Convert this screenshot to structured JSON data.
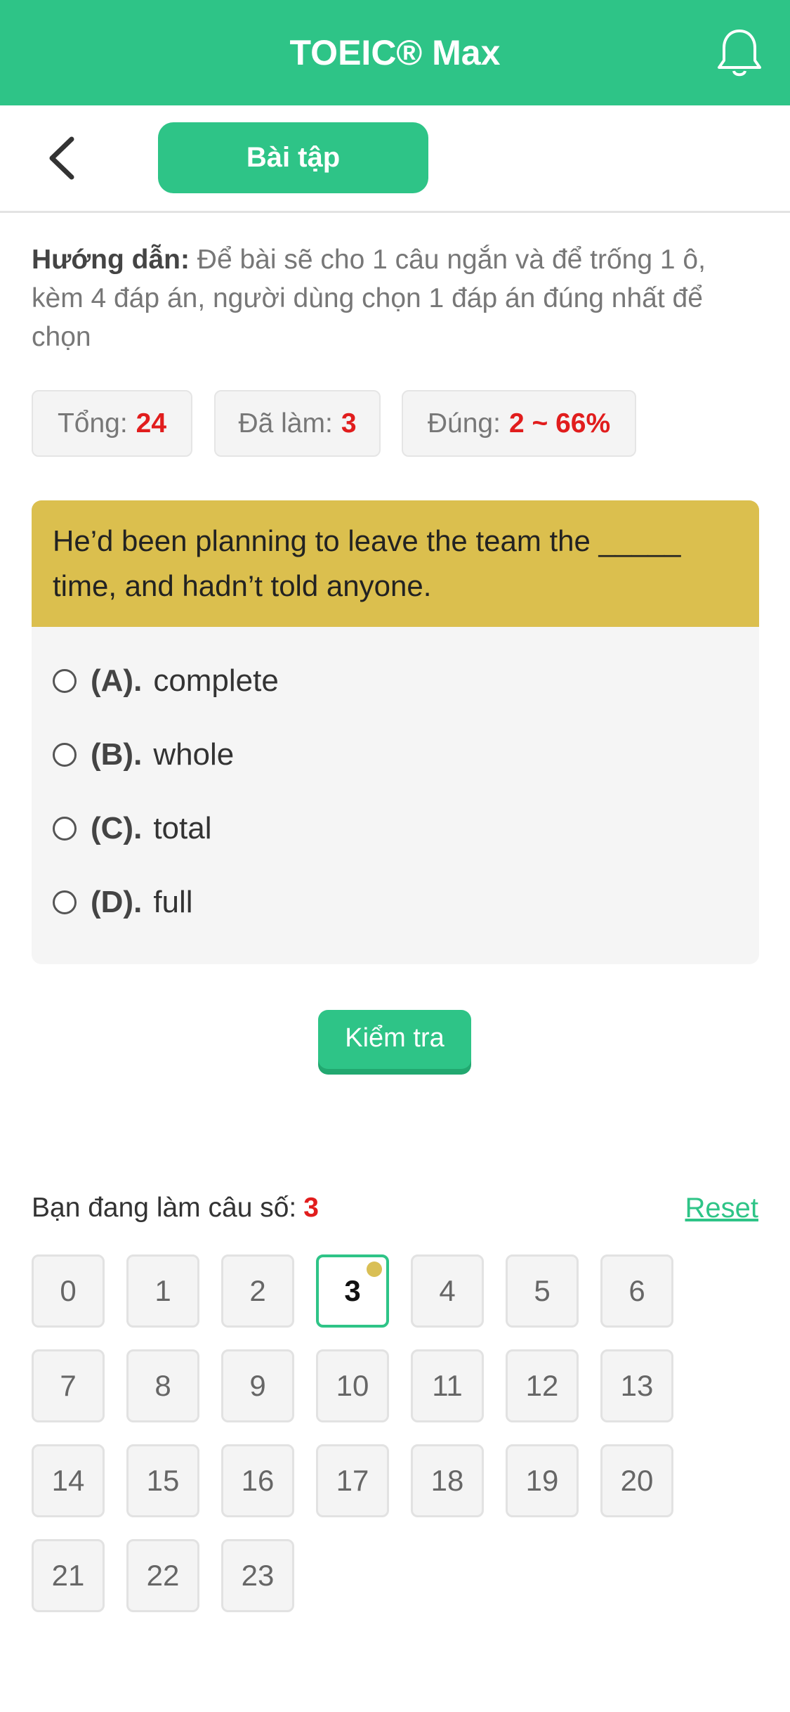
{
  "header": {
    "title": "TOEIC® Max",
    "bell_icon": "bell-icon",
    "bg_color": "#2ec487"
  },
  "subbar": {
    "back_icon": "chevron-left-icon",
    "tab_label": "Bài tập"
  },
  "guide": {
    "label": "Hướng dẫn:",
    "text": "Để bài sẽ cho 1 câu ngắn và để trống 1 ô, kèm 4 đáp án, người dùng chọn 1 đáp án đúng nhất để chọn"
  },
  "stats": [
    {
      "label": "Tổng:",
      "value": "24"
    },
    {
      "label": "Đã làm:",
      "value": "3"
    },
    {
      "label": "Đúng:",
      "value": "2 ~ 66%"
    }
  ],
  "question": {
    "text": "He’d been planning to leave the team the _____ time, and hadn’t told anyone.",
    "options": [
      {
        "key": "(A).",
        "text": "complete"
      },
      {
        "key": "(B).",
        "text": "whole"
      },
      {
        "key": "(C).",
        "text": "total"
      },
      {
        "key": "(D).",
        "text": "full"
      }
    ]
  },
  "check_button": "Kiểm tra",
  "progress": {
    "label": "Bạn đang làm câu số:",
    "current": "3",
    "reset": "Reset"
  },
  "numbers": [
    "0",
    "1",
    "2",
    "3",
    "4",
    "5",
    "6",
    "7",
    "8",
    "9",
    "10",
    "11",
    "12",
    "13",
    "14",
    "15",
    "16",
    "17",
    "18",
    "19",
    "20",
    "21",
    "22",
    "23"
  ],
  "colors": {
    "accent": "#2ec487",
    "question_bg": "#dbbf4e",
    "marker": "#d9bf55",
    "highlight": "#e11d1d"
  }
}
